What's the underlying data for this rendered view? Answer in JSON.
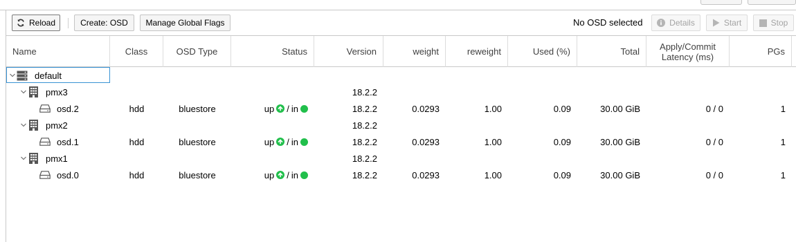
{
  "toolbar": {
    "reload_label": "Reload",
    "create_osd_label": "Create: OSD",
    "manage_flags_label": "Manage Global Flags",
    "selection_status": "No OSD selected",
    "details_label": "Details",
    "start_label": "Start",
    "stop_label": "Stop"
  },
  "columns": {
    "name": "Name",
    "class": "Class",
    "osd_type": "OSD Type",
    "status": "Status",
    "version": "Version",
    "weight": "weight",
    "reweight": "reweight",
    "used": "Used (%)",
    "total": "Total",
    "latency": "Apply/Commit Latency (ms)",
    "pgs": "PGs"
  },
  "tree": {
    "root": {
      "name": "default",
      "icon": "server-rack-icon"
    },
    "hosts": [
      {
        "name": "pmx3",
        "icon": "building-icon",
        "version": "18.2.2",
        "osd": {
          "name": "osd.2",
          "icon": "hdd-icon",
          "class": "hdd",
          "osd_type": "bluestore",
          "status_up": "up",
          "status_sep": "/",
          "status_in": "in",
          "version": "18.2.2",
          "weight": "0.0293",
          "reweight": "1.00",
          "used": "0.09",
          "total": "30.00 GiB",
          "latency": "0 / 0",
          "pgs": "1"
        }
      },
      {
        "name": "pmx2",
        "icon": "building-icon",
        "version": "18.2.2",
        "osd": {
          "name": "osd.1",
          "icon": "hdd-icon",
          "class": "hdd",
          "osd_type": "bluestore",
          "status_up": "up",
          "status_sep": "/",
          "status_in": "in",
          "version": "18.2.2",
          "weight": "0.0293",
          "reweight": "1.00",
          "used": "0.09",
          "total": "30.00 GiB",
          "latency": "0 / 0",
          "pgs": "1"
        }
      },
      {
        "name": "pmx1",
        "icon": "building-icon",
        "version": "18.2.2",
        "osd": {
          "name": "osd.0",
          "icon": "hdd-icon",
          "class": "hdd",
          "osd_type": "bluestore",
          "status_up": "up",
          "status_sep": "/",
          "status_in": "in",
          "version": "18.2.2",
          "weight": "0.0293",
          "reweight": "1.00",
          "used": "0.09",
          "total": "30.00 GiB",
          "latency": "0 / 0",
          "pgs": "1"
        }
      }
    ]
  },
  "colors": {
    "status_green": "#21bf4b",
    "selection_border": "#3892d4",
    "grid_border": "#c8c8c8"
  }
}
